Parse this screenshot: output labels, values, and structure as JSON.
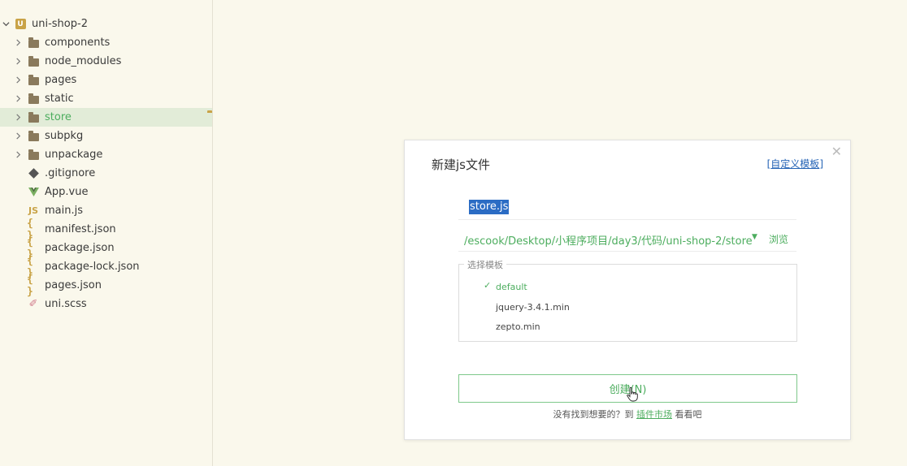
{
  "explorer": {
    "root": {
      "label": "uni-shop-2",
      "icon": "uni-app-icon"
    },
    "items": [
      {
        "label": "components",
        "type": "folder",
        "icon": "folder-icon"
      },
      {
        "label": "node_modules",
        "type": "folder",
        "icon": "folder-icon"
      },
      {
        "label": "pages",
        "type": "folder",
        "icon": "folder-icon"
      },
      {
        "label": "static",
        "type": "folder",
        "icon": "folder-icon"
      },
      {
        "label": "store",
        "type": "folder",
        "icon": "folder-icon",
        "selected": true
      },
      {
        "label": "subpkg",
        "type": "folder",
        "icon": "folder-icon"
      },
      {
        "label": "unpackage",
        "type": "folder",
        "icon": "folder-icon"
      },
      {
        "label": ".gitignore",
        "type": "file",
        "icon": "git-icon"
      },
      {
        "label": "App.vue",
        "type": "file",
        "icon": "vue-icon"
      },
      {
        "label": "main.js",
        "type": "file",
        "icon": "js-icon",
        "icon_text": "JS"
      },
      {
        "label": "manifest.json",
        "type": "file",
        "icon": "json-icon",
        "icon_text": "{ }"
      },
      {
        "label": "package.json",
        "type": "file",
        "icon": "json-icon",
        "icon_text": "{ }"
      },
      {
        "label": "package-lock.json",
        "type": "file",
        "icon": "json-icon",
        "icon_text": "{ }"
      },
      {
        "label": "pages.json",
        "type": "file",
        "icon": "json-icon",
        "icon_text": "{ }"
      },
      {
        "label": "uni.scss",
        "type": "file",
        "icon": "scss-icon"
      }
    ]
  },
  "dialog": {
    "title": "新建js文件",
    "custom_template_link": "自定义模板",
    "close_icon": "close-icon",
    "file_name": "store.js",
    "path": "/escook/Desktop/小程序项目/day3/代码/uni-shop-2/store",
    "browse_label": "浏览",
    "template_section_label": "选择模板",
    "templates": [
      {
        "label": "default",
        "selected": true
      },
      {
        "label": "jquery-3.4.1.min",
        "selected": false
      },
      {
        "label": "zepto.min",
        "selected": false
      }
    ],
    "create_button": "创建(N)",
    "footer": {
      "prefix": "没有找到想要的？到",
      "market_link": "插件市场",
      "suffix": "看看吧"
    }
  },
  "colors": {
    "background": "#faf8ec",
    "accent_green": "#4cad5e",
    "selection_blue": "#2b6cc4",
    "link_blue": "#2463b5",
    "icon_gold": "#c9a347"
  }
}
